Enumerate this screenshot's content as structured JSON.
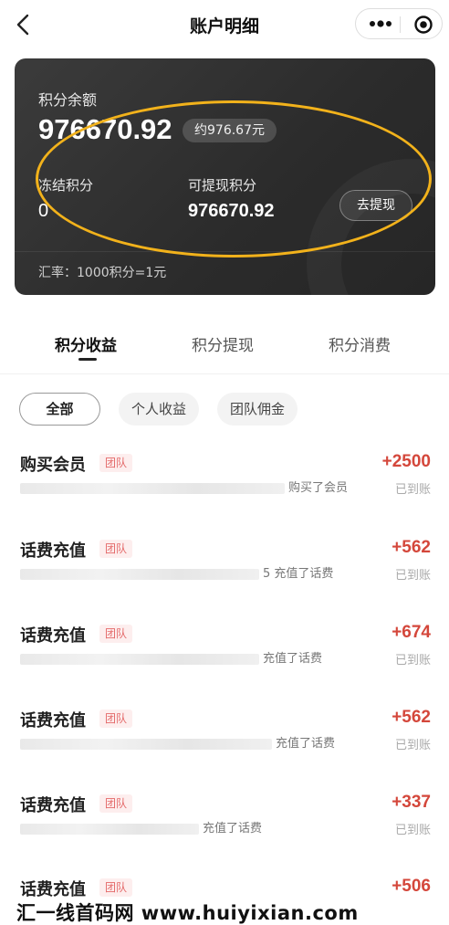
{
  "nav": {
    "title": "账户明细",
    "icons": [
      "back-arrow-icon",
      "more-dots-icon",
      "target-circle-icon"
    ]
  },
  "card": {
    "balance_label": "积分余额",
    "balance": "976670.92",
    "approx": "约976.67元",
    "frozen_label": "冻结积分",
    "frozen": "0",
    "withdrawable_label": "可提现积分",
    "withdrawable": "976670.92",
    "withdraw_button": "去提现",
    "rate": "汇率：1000积分=1元"
  },
  "tabs": [
    {
      "label": "积分收益",
      "active": true
    },
    {
      "label": "积分提现",
      "active": false
    },
    {
      "label": "积分消费",
      "active": false
    }
  ],
  "filters": [
    {
      "label": "全部",
      "active": true
    },
    {
      "label": "个人收益",
      "active": false
    },
    {
      "label": "团队佣金",
      "active": false
    }
  ],
  "records": [
    {
      "title": "购买会员",
      "tag": "团队",
      "desc": "购买了会员",
      "amount": "+2500",
      "status": "已到账"
    },
    {
      "title": "话费充值",
      "tag": "团队",
      "desc": "5 充值了话费",
      "amount": "+562",
      "status": "已到账"
    },
    {
      "title": "话费充值",
      "tag": "团队",
      "desc": "充值了话费",
      "amount": "+674",
      "status": "已到账"
    },
    {
      "title": "话费充值",
      "tag": "团队",
      "desc": "充值了话费",
      "amount": "+562",
      "status": "已到账"
    },
    {
      "title": "话费充值",
      "tag": "团队",
      "desc": "充值了话费",
      "amount": "+337",
      "status": "已到账"
    },
    {
      "title": "话费充值",
      "tag": "团队",
      "desc": "",
      "amount": "+506",
      "status": ""
    }
  ],
  "watermark": "汇一线首码网  www.huiyixian.com",
  "colors": {
    "card_bg": "#2e2e2e",
    "amount_red": "#d4473b",
    "highlight_ellipse": "#f2b21b",
    "tag_bg": "#fdeeee"
  }
}
